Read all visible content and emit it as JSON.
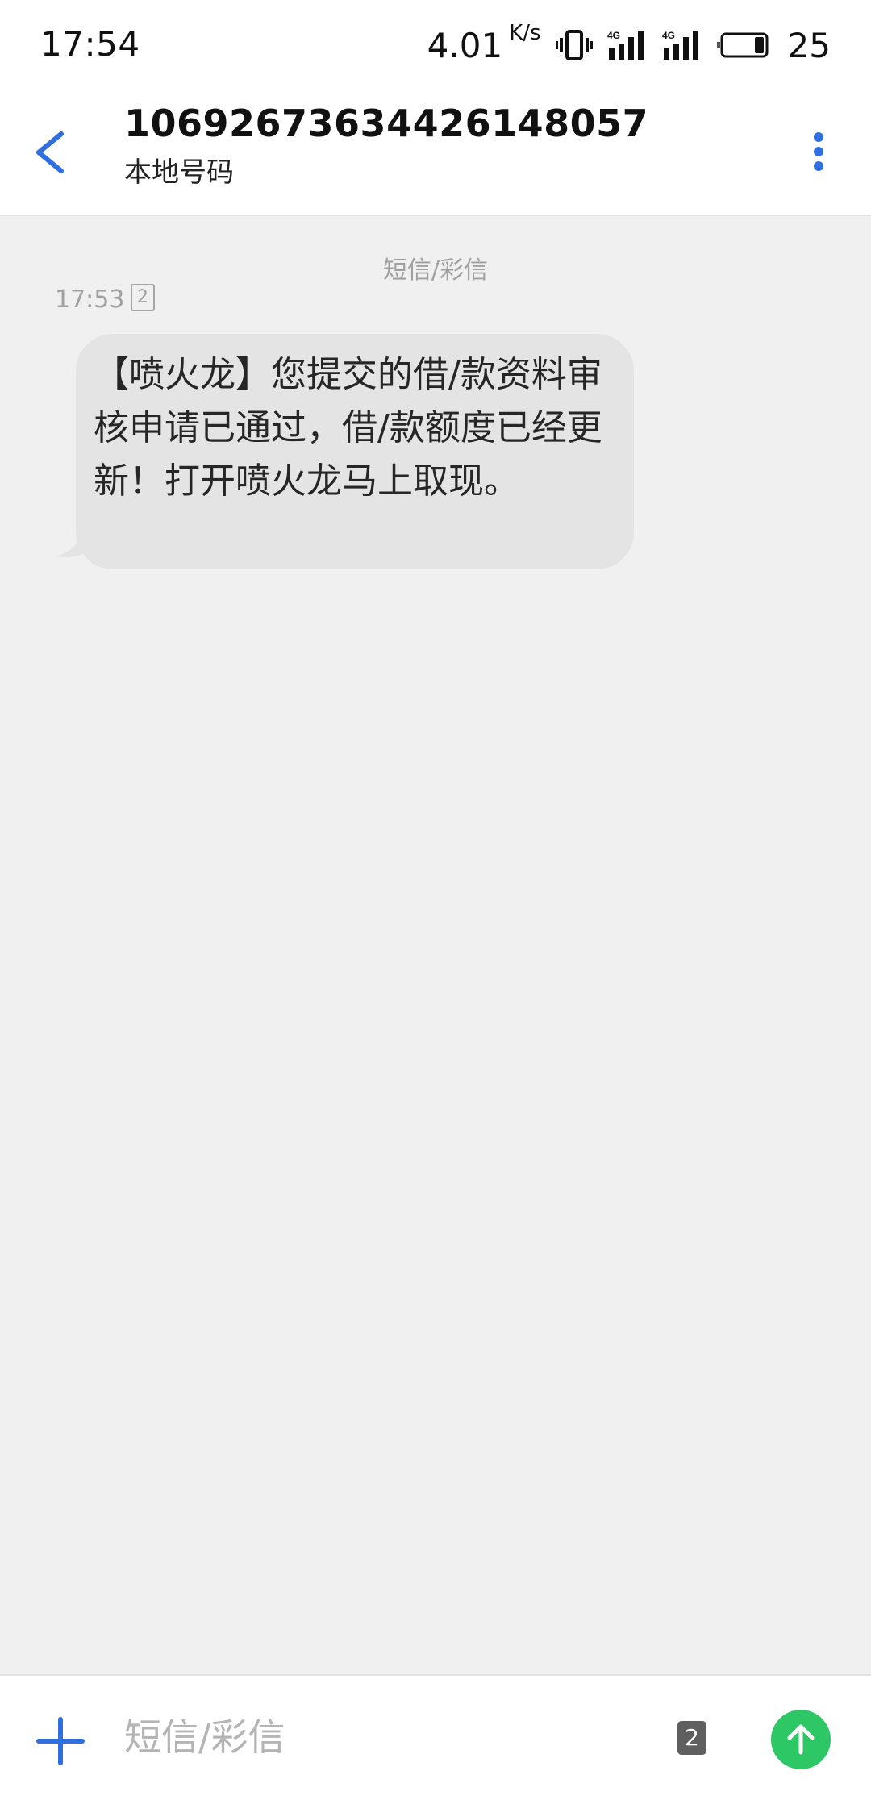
{
  "status_bar": {
    "time": "17:54",
    "net_speed": "4.01",
    "net_speed_unit": "K/s",
    "battery_level": "25",
    "icons": [
      "vibrate-icon",
      "signal-4g-sim1-icon",
      "signal-4g-sim2-icon",
      "battery-icon"
    ]
  },
  "header": {
    "contact_number": "10692673634426148057",
    "contact_label": "本地号码",
    "back_icon": "back-arrow-icon",
    "more_icon": "more-vertical-icon"
  },
  "conversation": {
    "type_label": "短信/彩信",
    "messages": [
      {
        "time": "17:53",
        "sim": "2",
        "text": "【喷火龙】您提交的借/款资料审核申请已通过，借/款额度已经更新！打开喷火龙马上取现。"
      }
    ]
  },
  "composer": {
    "placeholder": "短信/彩信",
    "value": "",
    "sim": "2",
    "add_icon": "plus-icon",
    "send_icon": "send-arrow-icon"
  },
  "colors": {
    "accent": "#2f6fe0",
    "send_button": "#2ec765",
    "bubble": "#e4e4e4",
    "background": "#f0f0f0"
  }
}
